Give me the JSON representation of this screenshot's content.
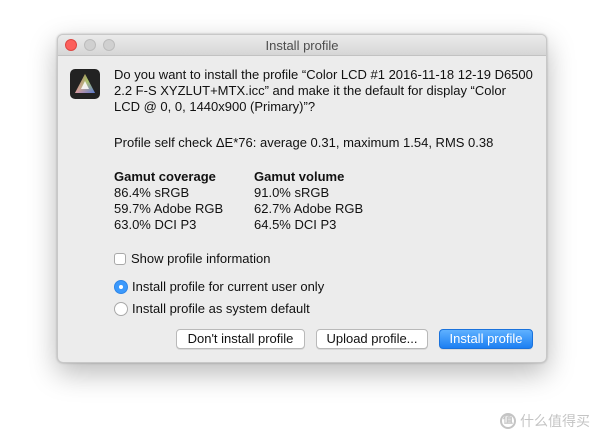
{
  "window": {
    "title": "Install profile"
  },
  "dialog": {
    "question": "Do you want to install the profile “Color LCD #1 2016-11-18 12-19 D6500 2.2 F-S XYZLUT+MTX.icc” and make it the default for display “Color LCD @ 0, 0, 1440x900 (Primary)”?",
    "self_check": "Profile self check ΔE*76: average 0.31, maximum 1.54, RMS 0.38",
    "gamut_coverage": {
      "header": "Gamut coverage",
      "rows": [
        "86.4% sRGB",
        "59.7% Adobe RGB",
        "63.0% DCI P3"
      ]
    },
    "gamut_volume": {
      "header": "Gamut volume",
      "rows": [
        "91.0% sRGB",
        "62.7% Adobe RGB",
        "64.5% DCI P3"
      ]
    },
    "show_info": {
      "label": "Show profile information",
      "checked": false
    },
    "install_scope": {
      "options": [
        {
          "label": "Install profile for current user only",
          "selected": true
        },
        {
          "label": "Install profile as system default",
          "selected": false
        }
      ]
    },
    "buttons": {
      "dont_install": "Don't install profile",
      "upload": "Upload profile...",
      "install": "Install profile"
    }
  },
  "watermark": {
    "text": "什么值得买",
    "badge": "值"
  },
  "colors": {
    "accent": "#3b99fc",
    "close": "#fc605c"
  },
  "icons": [
    "close-icon",
    "minimize-icon",
    "zoom-icon",
    "app-icon",
    "watermark-icon"
  ]
}
